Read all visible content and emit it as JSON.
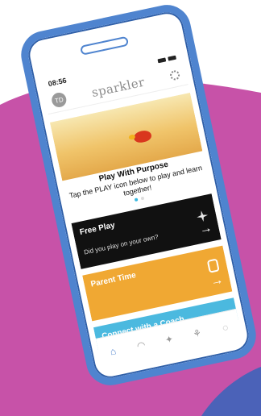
{
  "status": {
    "time": "08:56"
  },
  "header": {
    "avatar_initials": "TD",
    "brand": "sparkler"
  },
  "hero": {
    "title": "Play With Purpose",
    "subtitle": "Tap the PLAY icon below to play and learn together!"
  },
  "cards": {
    "free_play": {
      "title": "Free Play",
      "subtitle": "Did you play on your own?"
    },
    "parent_time": {
      "title": "Parent Time"
    },
    "coach": {
      "title": "Connect with a Coach"
    }
  },
  "nav": {
    "items": [
      {
        "label": "",
        "icon": "home-icon"
      },
      {
        "label": "",
        "icon": "rainbow-icon"
      },
      {
        "label": "",
        "icon": "sparkle-icon"
      },
      {
        "label": "",
        "icon": "plant-icon"
      },
      {
        "label": "",
        "icon": "chat-icon"
      }
    ]
  },
  "colors": {
    "phone_frame": "#4f84cf",
    "background_purple": "#c752a8",
    "free_play": "#111111",
    "parent_time": "#f0a833",
    "coach": "#4bb9df"
  }
}
